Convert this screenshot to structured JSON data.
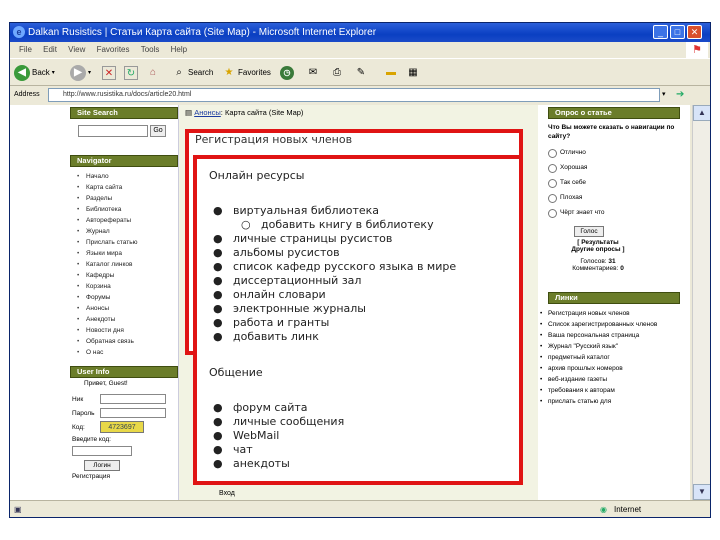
{
  "window": {
    "title": "Dalkan Rusistics | Статьи    Карта сайта (Site Map) - Microsoft Internet Explorer",
    "menu": [
      "File",
      "Edit",
      "View",
      "Favorites",
      "Tools",
      "Help"
    ]
  },
  "toolbar": {
    "back": "Back",
    "search": "Search",
    "favorites": "Favorites"
  },
  "address": {
    "label": "Address",
    "url": "http://www.rusistika.ru/docs/article20.html"
  },
  "statusbar": {
    "zone": "Internet"
  },
  "left": {
    "site_search_title": "Site Search",
    "search_button": "Go",
    "navigator_title": "Navigator",
    "nav_items": [
      "Начало",
      "Карта сайта",
      "Разделы",
      "Библиотека",
      "Авторефераты",
      "Журнал",
      "Прислать статью",
      "Языки мира",
      "Каталог линков",
      "Кафедры",
      "Корзина",
      "Форумы",
      "Анонсы",
      "Анекдоты",
      "Новости дня",
      "Обратная связь",
      "О нас"
    ],
    "user_info_title": "User Info",
    "greeting": "Привет, Guest!",
    "login_label": "Ник",
    "password_label": "Пароль",
    "code_label": "Код:",
    "captcha": "4723697",
    "enter_code_label": "Введите код:",
    "login_button": "Логин",
    "register_link": "Регистрация"
  },
  "middle": {
    "breadcrumb_anons": "Анонсы",
    "breadcrumb_page": "Карта сайта (Site Map)",
    "footer_link": "Вход"
  },
  "right": {
    "poll_title": "Опрос о статье",
    "poll_question": "Что Вы можете сказать о навигации по сайту?",
    "poll_options": [
      "Отлично",
      "Хорошая",
      "Так себе",
      "Плохая",
      "Чёрт знает что"
    ],
    "vote_button": "Голос",
    "results_link": "[ Результаты",
    "other_polls_link": "Другие опросы ]",
    "votes_label": "Голосов:",
    "votes_count": "31",
    "comments_label": "Комментариев:",
    "comments_count": "0",
    "links_title": "Линки",
    "links": [
      "Регистрация новых членов",
      "Список зарегистрированных членов",
      "Ваша персональная страница",
      "Журнал \"Русский язык\"",
      "предметный каталог",
      "архив прошлых номеров",
      "веб-издание газеты",
      "требования к авторам",
      "прислать статью для"
    ]
  },
  "menu_overlay": {
    "title": "Регистрация новых членов",
    "online_header": "Онлайн ресурсы",
    "online_items": [
      "виртуальная библиотека",
      "личные страницы русистов",
      "альбомы русистов",
      "список кафедр русского языка в мире",
      "диссертационный зал",
      "онлайн словари",
      "электронные журналы",
      "работа и гранты",
      "добавить линк"
    ],
    "online_subitem": "добавить книгу в библиотеку",
    "community_header": "Общение",
    "community_items": [
      "форум сайта",
      "личные сообщения",
      "WebMail",
      "чат",
      "анекдоты"
    ]
  }
}
